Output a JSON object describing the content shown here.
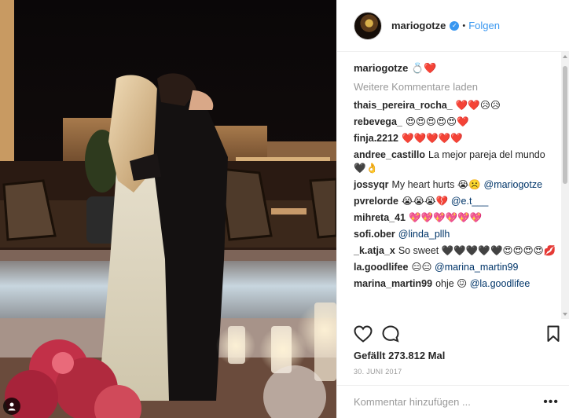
{
  "post": {
    "username": "mariogotze",
    "verified_mark": "✓",
    "separator": "•",
    "follow_label": "Folgen",
    "caption_user": "mariogotze",
    "caption_text": "💍❤️",
    "load_more_label": "Weitere Kommentare laden",
    "likes_text": "Gefällt 273.812 Mal",
    "date_text": "30. JUNI 2017",
    "add_comment_placeholder": "Kommentar hinzufügen ...",
    "more_options": "•••"
  },
  "comments": [
    {
      "user": "thais_pereira_rocha_",
      "text": "❤️❤️😥😥",
      "mention": ""
    },
    {
      "user": "rebevega_",
      "text": "😍😍😍😍😍❤️",
      "mention": ""
    },
    {
      "user": "finja.2212",
      "text": "❤️❤️❤️❤️❤️",
      "mention": ""
    },
    {
      "user": "andree_castillo",
      "text": "La mejor pareja del mundo🖤👌",
      "mention": ""
    },
    {
      "user": "jossyqr",
      "text": "My heart hurts 😭☹️",
      "mention": "@mariogotze"
    },
    {
      "user": "pvrelorde",
      "text": "😭😭😭💔",
      "mention": "@e.t___"
    },
    {
      "user": "mihreta_41",
      "text": "💖💖💖💖💖💖",
      "mention": ""
    },
    {
      "user": "sofi.ober",
      "text": "",
      "mention": "@linda_pllh"
    },
    {
      "user": "_k.atja_x",
      "text": "So sweet 🖤🖤🖤🖤🖤😍😍😍😍💋",
      "mention": ""
    },
    {
      "user": "la.goodlifee",
      "text": "😑😑",
      "mention": "@marina_martin99"
    },
    {
      "user": "marina_martin99",
      "text": "ohje 😖",
      "mention": "@la.goodlifee"
    }
  ],
  "icons": {
    "like": "heart-icon",
    "comment": "comment-icon",
    "save": "bookmark-icon",
    "profile_overlay": "person-icon"
  },
  "colors": {
    "link": "#3897f0",
    "mention": "#003569",
    "muted": "#999999",
    "text": "#262626"
  }
}
